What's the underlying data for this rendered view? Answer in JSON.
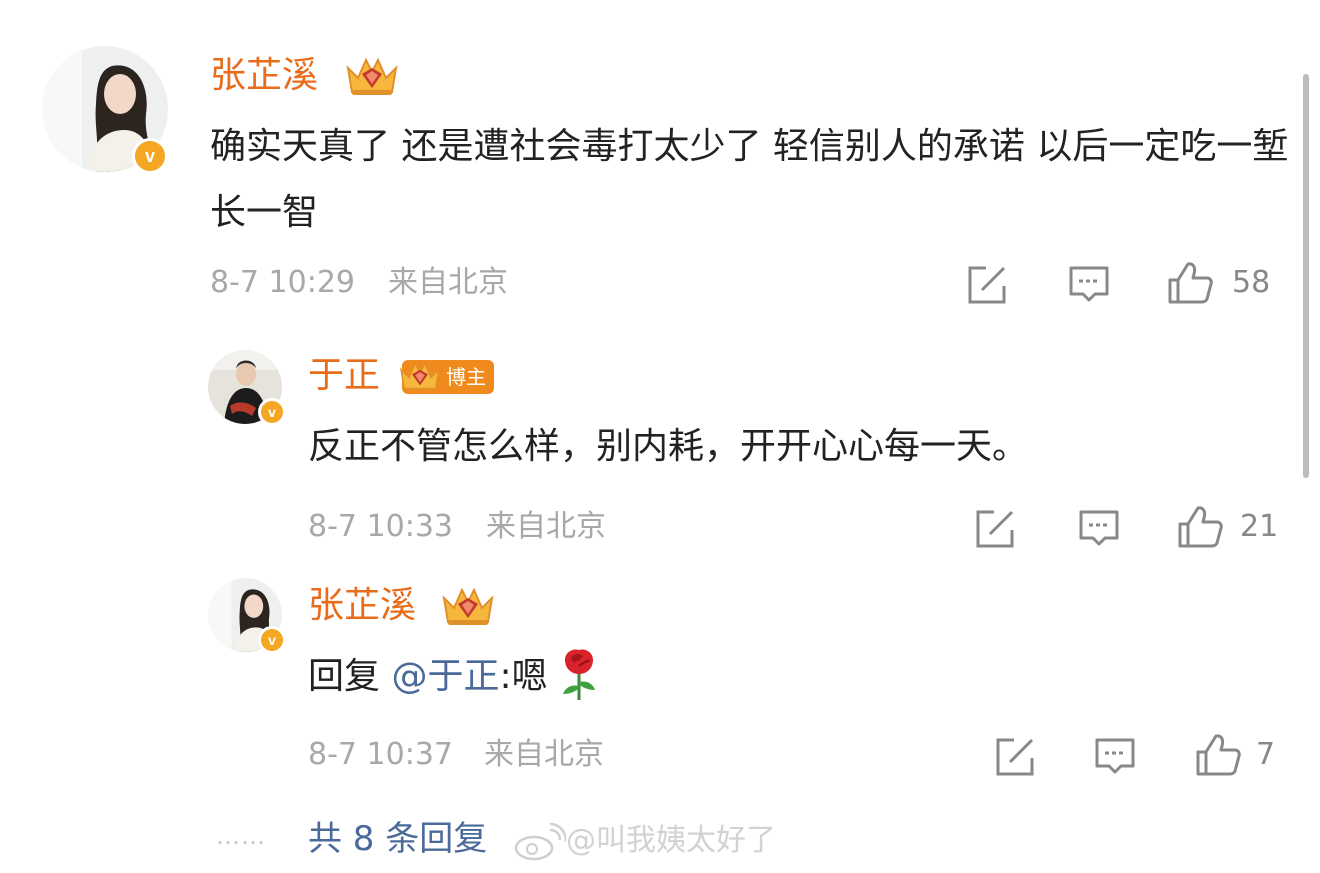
{
  "comments": [
    {
      "user": "张芷溪",
      "text": "确实天真了 还是遭社会毒打太少了 轻信别人的承诺 以后一定吃一堑长一智",
      "time": "8-7 10:29",
      "location": "来自北京",
      "likes": "58",
      "badge_icon": "crown-icon",
      "verified_icon": "verified-v-icon"
    },
    {
      "user": "于正",
      "tag": "博主",
      "text": "反正不管怎么样，别内耗，开开心心每一天。",
      "time": "8-7 10:33",
      "location": "来自北京",
      "likes": "21",
      "badge_icon": "crown-icon",
      "verified_icon": "verified-v-icon"
    },
    {
      "user": "张芷溪",
      "reply_prefix": "回复",
      "mention": "@于正",
      "reply_suffix": ":嗯",
      "emoji": "rose-icon",
      "time": "8-7 10:37",
      "location": "来自北京",
      "likes": "7",
      "badge_icon": "crown-icon",
      "verified_icon": "verified-v-icon"
    }
  ],
  "more_dots": "……",
  "more_replies": "共 8 条回复",
  "watermark": "@叫我姨太好了",
  "verified_letter": "v",
  "colors": {
    "name": "#e86c1a",
    "mention": "#4a6a99",
    "meta": "#a8a8a8",
    "badge": "#f5a623"
  }
}
